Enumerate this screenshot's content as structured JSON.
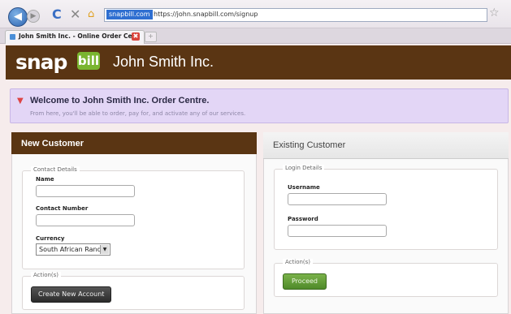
{
  "browser": {
    "url_site_label": "snapbill.com",
    "url": "https://john.snapbill.com/signup",
    "tab_title": "John Smith Inc. - Online Order Ce...",
    "tab_close_glyph": "✖",
    "new_tab_glyph": "+",
    "icons": [
      "back-icon",
      "forward-icon",
      "refresh-icon",
      "stop-icon",
      "home-icon",
      "site-favicon",
      "favorite-star-icon"
    ]
  },
  "header": {
    "logo_text": "snap",
    "logo_box_text": "bill",
    "company": "John Smith Inc."
  },
  "welcome": {
    "title": "Welcome to John Smith Inc. Order Centre.",
    "subtitle": "From here, you'll be able to order, pay for, and activate any of our services."
  },
  "new_customer": {
    "title": "New Customer",
    "contact_legend": "Contact Details",
    "name_label": "Name",
    "name_value": "",
    "contact_label": "Contact Number",
    "contact_value": "",
    "currency_label": "Currency",
    "currency_selected": "South African Rand",
    "actions_legend": "Action(s)",
    "create_button": "Create New Account"
  },
  "existing_customer": {
    "title": "Existing Customer",
    "login_legend": "Login Details",
    "username_label": "Username",
    "username_value": "",
    "password_label": "Password",
    "password_value": "",
    "actions_legend": "Action(s)",
    "proceed_button": "Proceed"
  },
  "colors": {
    "brand_brown": "#5a3513",
    "accent_green": "#7ab530",
    "welcome_bg": "#e3d6f6"
  }
}
